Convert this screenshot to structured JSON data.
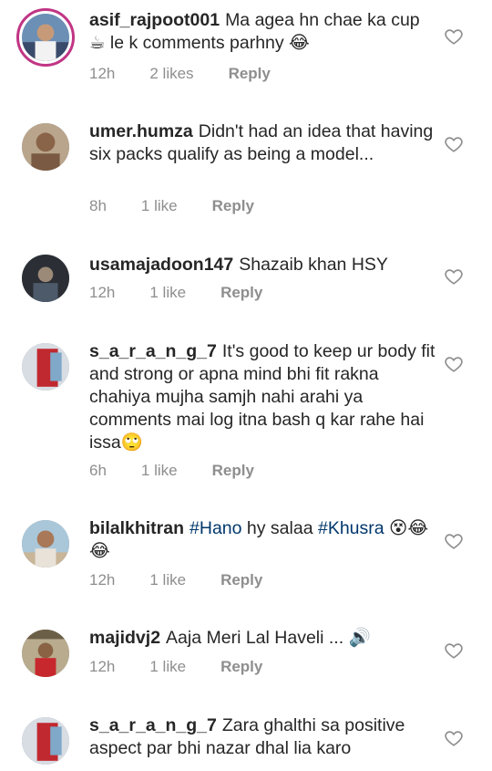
{
  "comments": [
    {
      "username": "asif_rajpoot001",
      "text": "Ma agea hn chae ka cup ☕ le k comments parhny 😂",
      "time": "12h",
      "likes": "2 likes",
      "reply": "Reply"
    },
    {
      "username": "umer.humza",
      "text": "Didn't had an idea that having six packs qualify as being a model...",
      "time": "8h",
      "likes": "1 like",
      "reply": "Reply"
    },
    {
      "username": "usamajadoon147",
      "text": "Shazaib khan HSY",
      "time": "12h",
      "likes": "1 like",
      "reply": "Reply"
    },
    {
      "username": "s_a_r_a_n_g_7",
      "text": "It's good to keep ur body fit and strong or apna mind bhi fit rakna chahiya mujha samjh nahi arahi ya comments mai log itna bash q kar rahe hai issa🙄",
      "time": "6h",
      "likes": "1 like",
      "reply": "Reply"
    },
    {
      "username": "bilalkhitran",
      "text_parts": [
        "#Hano",
        " hy salaa ",
        "#Khusra",
        " 😵😂😂"
      ],
      "time": "12h",
      "likes": "1 like",
      "reply": "Reply"
    },
    {
      "username": "majidvj2",
      "text": "Aaja Meri Lal Haveli ... 🔊",
      "time": "12h",
      "likes": "1 like",
      "reply": "Reply"
    },
    {
      "username": "s_a_r_a_n_g_7",
      "text": "Zara ghalthi sa positive aspect par bhi nazar dhal lia karo"
    }
  ],
  "colors": {
    "hashtag": "#00376b",
    "meta": "#8e8e8e",
    "ring": "#c13584"
  },
  "icons": {
    "like": "heart-outline-icon"
  }
}
